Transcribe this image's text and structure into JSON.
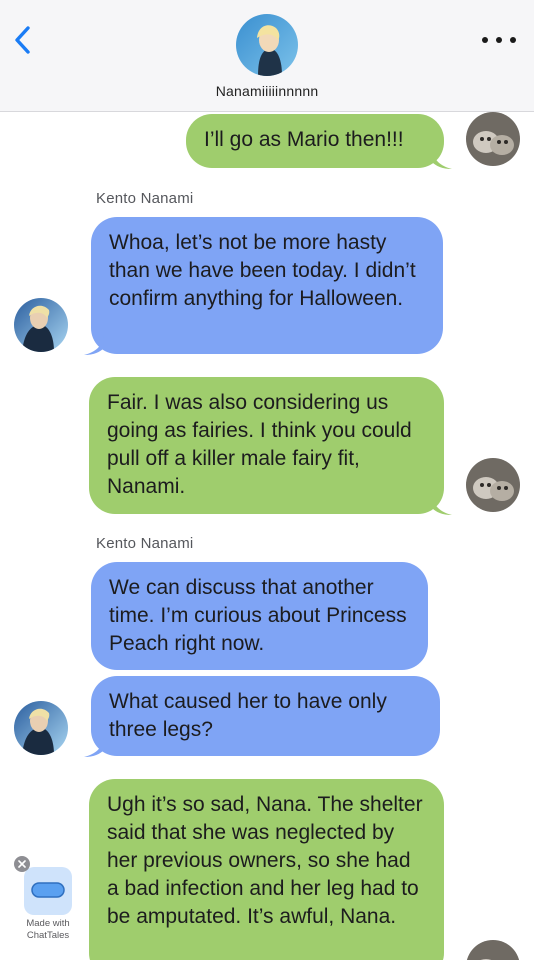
{
  "header": {
    "contact_name": "Nanamiiiiinnnnn",
    "back_icon": "chevron-left-icon",
    "more_icon": "ellipsis-icon"
  },
  "messages": [
    {
      "direction": "outgoing",
      "text": "I’ll go as Mario then!!!"
    },
    {
      "direction": "incoming",
      "sender": "Kento Nanami",
      "text": "Whoa, let’s not be more hasty than we have been today. I didn’t confirm anything for Halloween."
    },
    {
      "direction": "outgoing",
      "text": "Fair. I was also considering us going as fairies. I think you could pull off a killer male fairy fit, Nanami."
    },
    {
      "direction": "incoming",
      "sender": "Kento Nanami",
      "text": "We can discuss that another time. I’m curious about Princess Peach right now."
    },
    {
      "direction": "incoming",
      "text": "What caused her to have only three legs?"
    },
    {
      "direction": "outgoing",
      "text": "Ugh it’s so sad, Nana. The shelter said that she was neglected by her previous owners, so she had a bad infection and her leg had to be amputated. It’s awful, Nana."
    }
  ],
  "watermark": {
    "line1": "Made with",
    "line2": "ChatTales"
  },
  "colors": {
    "outgoing_bubble": "#9fcd6d",
    "incoming_bubble": "#7fa4f5",
    "accent": "#1a7cf5"
  }
}
